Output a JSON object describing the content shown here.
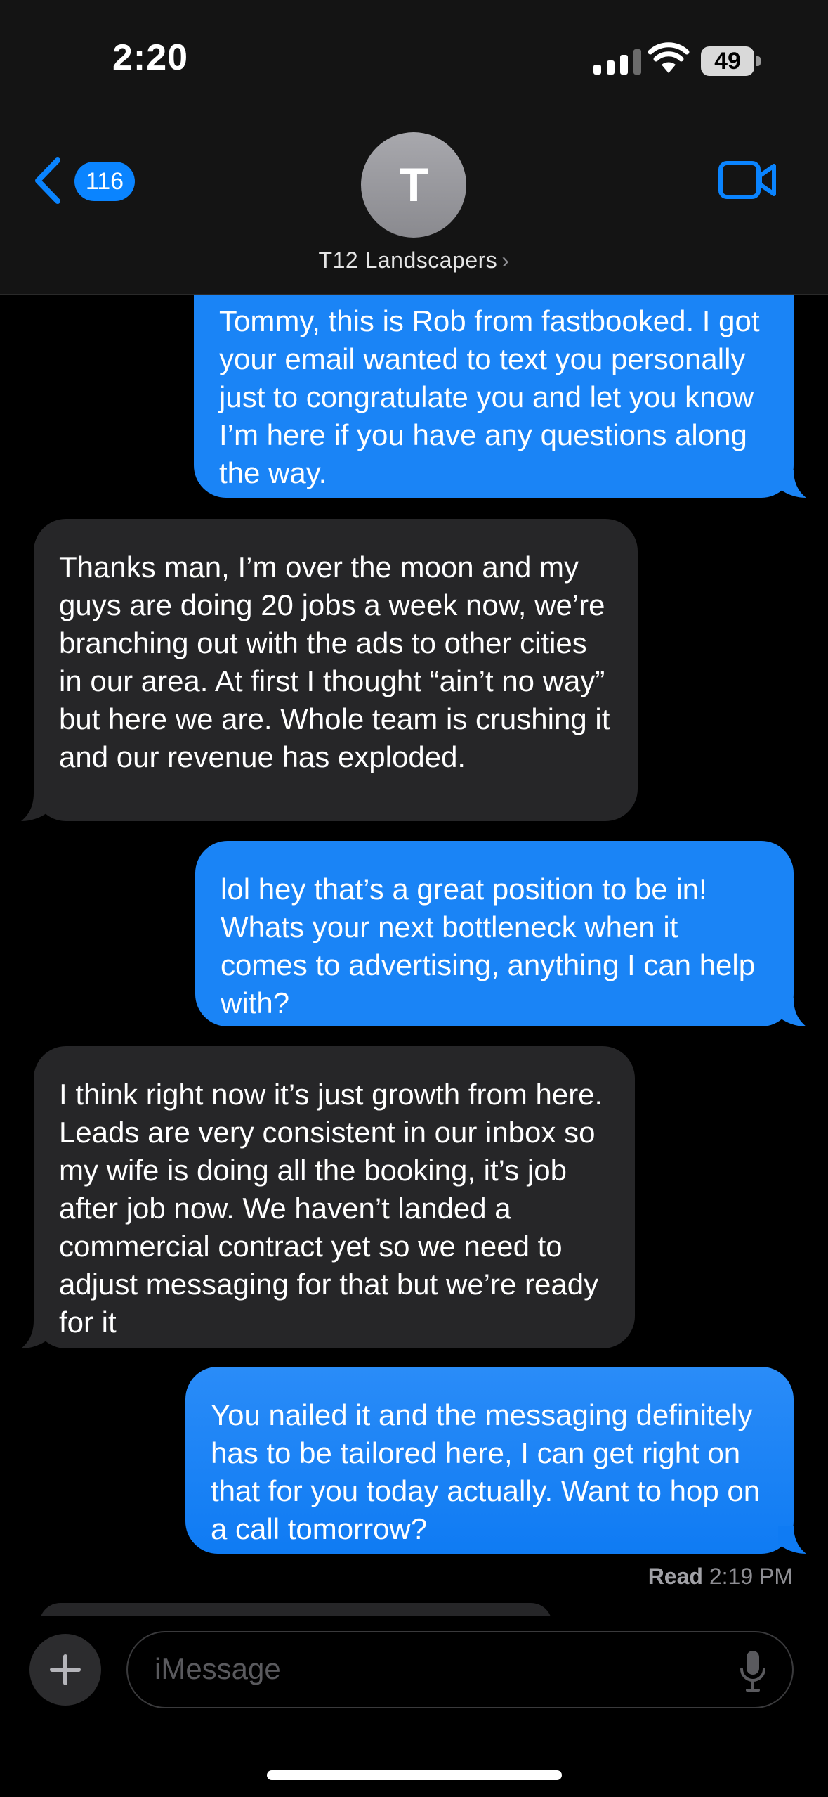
{
  "status": {
    "time": "2:20",
    "battery": "49"
  },
  "header": {
    "back_count": "116",
    "avatar_initial": "T",
    "contact_name": "T12 Landscapers",
    "chevron": "›"
  },
  "messages": [
    {
      "dir": "out",
      "text": "Tommy, this is Rob from fastbooked. I got your email wanted to text you personally just to congratulate you and let you know I’m here if you have any questions along the way."
    },
    {
      "dir": "in",
      "text": "Thanks man, I’m over the moon and my guys are doing 20 jobs a week now, we’re branching out with the ads to other cities in our area. At first I thought “ain’t no way” but here we are. Whole team is crushing it and our revenue has exploded."
    },
    {
      "dir": "out",
      "text": "lol hey that’s a great position to be in! Whats your next bottleneck when it comes to advertising, anything I can help with?"
    },
    {
      "dir": "in",
      "text": "I think right now it’s just growth from here. Leads are very consistent in our inbox so my wife is doing all the booking, it’s job after job now. We haven’t landed a commercial contract yet so we need to adjust messaging for that but we’re ready for it"
    },
    {
      "dir": "out",
      "text": "You nailed it and the messaging definitely has to be tailored here, I can get right on that for you today actually. Want to hop on a call tomorrow?"
    }
  ],
  "receipt": {
    "label": "Read",
    "time": "2:19 PM"
  },
  "composer": {
    "placeholder": "iMessage"
  },
  "colors": {
    "outgoing": "#1a84f6",
    "incoming": "#262628",
    "accent": "#0a84ff"
  },
  "icons": [
    "back-chevron-icon",
    "video-camera-icon",
    "plus-icon",
    "microphone-icon",
    "signal-icon",
    "wifi-icon",
    "battery-icon"
  ]
}
